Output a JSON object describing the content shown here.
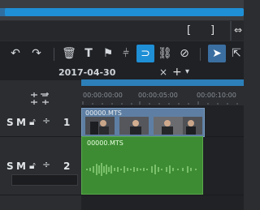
{
  "toolbar_top": {
    "bracket_in": "[",
    "bracket_out": "]",
    "icons": [
      "progress-bar"
    ]
  },
  "toolbar": {
    "buttons": [
      "undo",
      "redo",
      "delete",
      "text",
      "marker",
      "chapter",
      "magnet",
      "link",
      "unlink",
      "pointer",
      "range"
    ]
  },
  "tabs": {
    "active_label": "2017-04-30",
    "close_symbol": "×",
    "add_symbol": "+",
    "dropdown_symbol": "▾"
  },
  "ruler": {
    "labels": [
      "00:00:00:00",
      "00:00:05:00",
      "00:00:10:00"
    ]
  },
  "tracks": [
    {
      "number": "1",
      "solo": "S",
      "mute": "M",
      "clip_name": "00000.MTS"
    },
    {
      "number": "2",
      "solo": "S",
      "mute": "M",
      "clip_name": "00000.MTS"
    }
  ],
  "colors": {
    "accent": "#1f8fd6",
    "video_clip": "#5e7fa3",
    "audio_clip": "#3d8c33"
  }
}
